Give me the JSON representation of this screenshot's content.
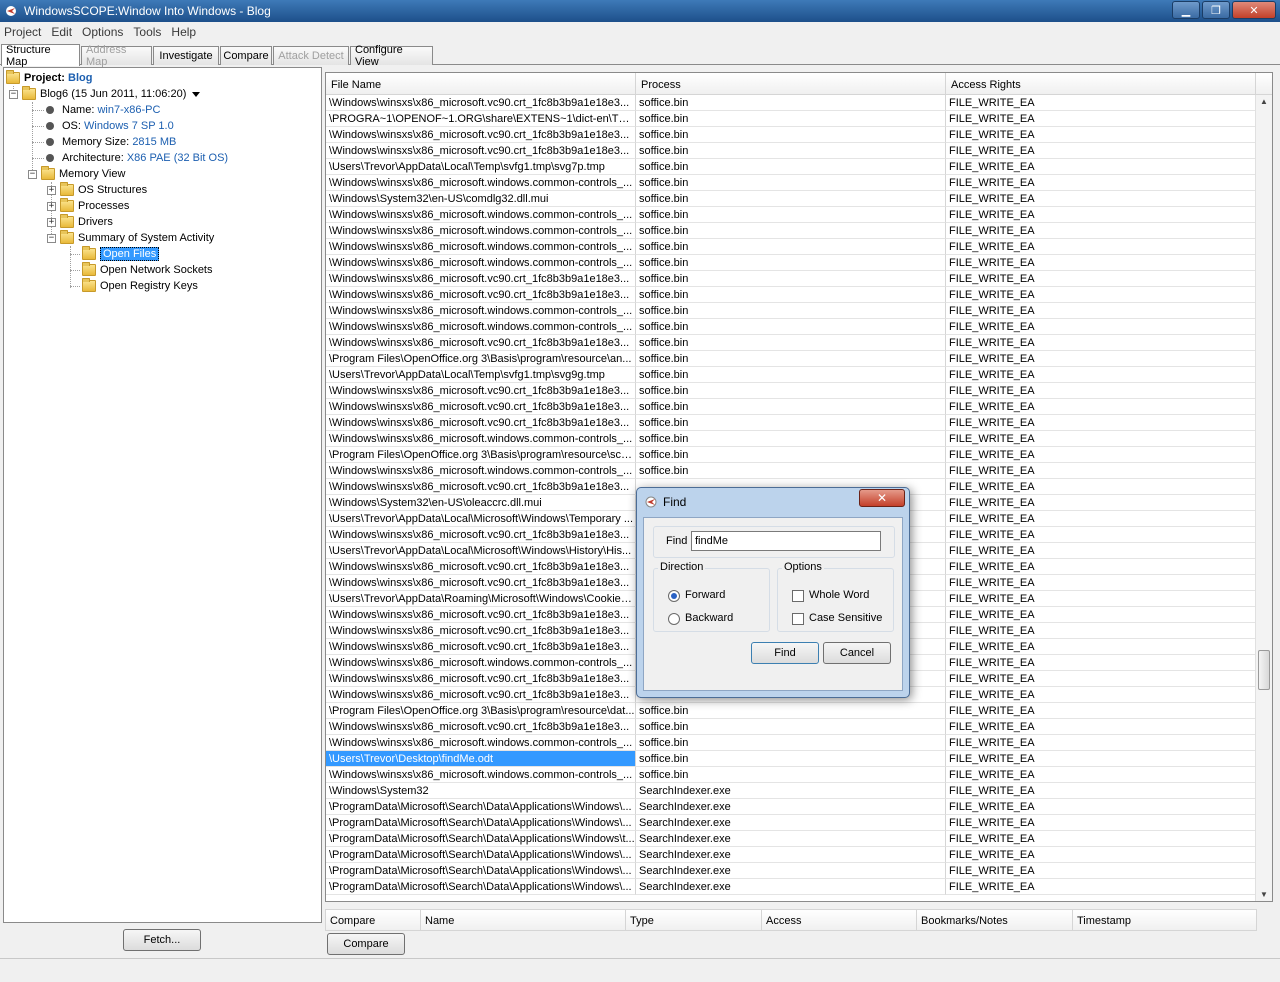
{
  "window": {
    "title": "WindowsSCOPE:Window Into Windows - Blog",
    "minimize": "▁",
    "maximize": "❐",
    "close": "✕"
  },
  "menu": [
    "Project",
    "Edit",
    "Options",
    "Tools",
    "Help"
  ],
  "tabs": [
    {
      "label": "Structure Map",
      "active": true,
      "disabled": false
    },
    {
      "label": "Address Map",
      "active": false,
      "disabled": true
    },
    {
      "label": "Investigate",
      "active": false,
      "disabled": false
    },
    {
      "label": "Compare",
      "active": false,
      "disabled": false
    },
    {
      "label": "Attack Detect",
      "active": false,
      "disabled": true
    },
    {
      "label": "Configure View",
      "active": false,
      "disabled": false
    }
  ],
  "tree": {
    "project_label": "Project:",
    "project_name": "Blog",
    "snapshot": "Blog6 (15 Jun 2011, 11:06:20)",
    "props": [
      {
        "key": "Name:",
        "value": "win7-x86-PC"
      },
      {
        "key": "OS:",
        "value": "Windows 7 SP 1.0"
      },
      {
        "key": "Memory Size:",
        "value": "2815 MB"
      },
      {
        "key": "Architecture:",
        "value": "X86 PAE (32 Bit OS)"
      }
    ],
    "memory_view": "Memory View",
    "children": [
      "OS Structures",
      "Processes",
      "Drivers",
      "Summary of System Activity"
    ],
    "activity": [
      "Open Files",
      "Open Network Sockets",
      "Open Registry Keys"
    ],
    "selected": "Open Files"
  },
  "fetch_label": "Fetch...",
  "table": {
    "columns": [
      "File Name",
      "Process",
      "Access Rights"
    ],
    "rows": [
      [
        "\\Windows\\winsxs\\x86_microsoft.vc90.crt_1fc8b3b9a1e18e3...",
        "soffice.bin",
        "FILE_WRITE_EA"
      ],
      [
        "\\PROGRA~1\\OPENOF~1.ORG\\share\\EXTENS~1\\dict-en\\TH_...",
        "soffice.bin",
        "FILE_WRITE_EA"
      ],
      [
        "\\Windows\\winsxs\\x86_microsoft.vc90.crt_1fc8b3b9a1e18e3...",
        "soffice.bin",
        "FILE_WRITE_EA"
      ],
      [
        "\\Windows\\winsxs\\x86_microsoft.vc90.crt_1fc8b3b9a1e18e3...",
        "soffice.bin",
        "FILE_WRITE_EA"
      ],
      [
        "\\Users\\Trevor\\AppData\\Local\\Temp\\svfg1.tmp\\svg7p.tmp",
        "soffice.bin",
        "FILE_WRITE_EA"
      ],
      [
        "\\Windows\\winsxs\\x86_microsoft.windows.common-controls_...",
        "soffice.bin",
        "FILE_WRITE_EA"
      ],
      [
        "\\Windows\\System32\\en-US\\comdlg32.dll.mui",
        "soffice.bin",
        "FILE_WRITE_EA"
      ],
      [
        "\\Windows\\winsxs\\x86_microsoft.windows.common-controls_...",
        "soffice.bin",
        "FILE_WRITE_EA"
      ],
      [
        "\\Windows\\winsxs\\x86_microsoft.windows.common-controls_...",
        "soffice.bin",
        "FILE_WRITE_EA"
      ],
      [
        "\\Windows\\winsxs\\x86_microsoft.windows.common-controls_...",
        "soffice.bin",
        "FILE_WRITE_EA"
      ],
      [
        "\\Windows\\winsxs\\x86_microsoft.windows.common-controls_...",
        "soffice.bin",
        "FILE_WRITE_EA"
      ],
      [
        "\\Windows\\winsxs\\x86_microsoft.vc90.crt_1fc8b3b9a1e18e3...",
        "soffice.bin",
        "FILE_WRITE_EA"
      ],
      [
        "\\Windows\\winsxs\\x86_microsoft.vc90.crt_1fc8b3b9a1e18e3...",
        "soffice.bin",
        "FILE_WRITE_EA"
      ],
      [
        "\\Windows\\winsxs\\x86_microsoft.windows.common-controls_...",
        "soffice.bin",
        "FILE_WRITE_EA"
      ],
      [
        "\\Windows\\winsxs\\x86_microsoft.windows.common-controls_...",
        "soffice.bin",
        "FILE_WRITE_EA"
      ],
      [
        "\\Windows\\winsxs\\x86_microsoft.vc90.crt_1fc8b3b9a1e18e3...",
        "soffice.bin",
        "FILE_WRITE_EA"
      ],
      [
        "\\Program Files\\OpenOffice.org 3\\Basis\\program\\resource\\an...",
        "soffice.bin",
        "FILE_WRITE_EA"
      ],
      [
        "\\Users\\Trevor\\AppData\\Local\\Temp\\svfg1.tmp\\svg9g.tmp",
        "soffice.bin",
        "FILE_WRITE_EA"
      ],
      [
        "\\Windows\\winsxs\\x86_microsoft.vc90.crt_1fc8b3b9a1e18e3...",
        "soffice.bin",
        "FILE_WRITE_EA"
      ],
      [
        "\\Windows\\winsxs\\x86_microsoft.vc90.crt_1fc8b3b9a1e18e3...",
        "soffice.bin",
        "FILE_WRITE_EA"
      ],
      [
        "\\Windows\\winsxs\\x86_microsoft.vc90.crt_1fc8b3b9a1e18e3...",
        "soffice.bin",
        "FILE_WRITE_EA"
      ],
      [
        "\\Windows\\winsxs\\x86_microsoft.windows.common-controls_...",
        "soffice.bin",
        "FILE_WRITE_EA"
      ],
      [
        "\\Program Files\\OpenOffice.org 3\\Basis\\program\\resource\\sce...",
        "soffice.bin",
        "FILE_WRITE_EA"
      ],
      [
        "\\Windows\\winsxs\\x86_microsoft.windows.common-controls_...",
        "soffice.bin",
        "FILE_WRITE_EA"
      ],
      [
        "\\Windows\\winsxs\\x86_microsoft.vc90.crt_1fc8b3b9a1e18e3...",
        "",
        "FILE_WRITE_EA"
      ],
      [
        "\\Windows\\System32\\en-US\\oleaccrc.dll.mui",
        "",
        "FILE_WRITE_EA"
      ],
      [
        "\\Users\\Trevor\\AppData\\Local\\Microsoft\\Windows\\Temporary ...",
        "",
        "FILE_WRITE_EA"
      ],
      [
        "\\Windows\\winsxs\\x86_microsoft.vc90.crt_1fc8b3b9a1e18e3...",
        "",
        "FILE_WRITE_EA"
      ],
      [
        "\\Users\\Trevor\\AppData\\Local\\Microsoft\\Windows\\History\\His...",
        "",
        "FILE_WRITE_EA"
      ],
      [
        "\\Windows\\winsxs\\x86_microsoft.vc90.crt_1fc8b3b9a1e18e3...",
        "",
        "FILE_WRITE_EA"
      ],
      [
        "\\Windows\\winsxs\\x86_microsoft.vc90.crt_1fc8b3b9a1e18e3...",
        "",
        "FILE_WRITE_EA"
      ],
      [
        "\\Users\\Trevor\\AppData\\Roaming\\Microsoft\\Windows\\Cookies...",
        "",
        "FILE_WRITE_EA"
      ],
      [
        "\\Windows\\winsxs\\x86_microsoft.vc90.crt_1fc8b3b9a1e18e3...",
        "",
        "FILE_WRITE_EA"
      ],
      [
        "\\Windows\\winsxs\\x86_microsoft.vc90.crt_1fc8b3b9a1e18e3...",
        "",
        "FILE_WRITE_EA"
      ],
      [
        "\\Windows\\winsxs\\x86_microsoft.vc90.crt_1fc8b3b9a1e18e3...",
        "",
        "FILE_WRITE_EA"
      ],
      [
        "\\Windows\\winsxs\\x86_microsoft.windows.common-controls_...",
        "",
        "FILE_WRITE_EA"
      ],
      [
        "\\Windows\\winsxs\\x86_microsoft.vc90.crt_1fc8b3b9a1e18e3...",
        "",
        "FILE_WRITE_EA"
      ],
      [
        "\\Windows\\winsxs\\x86_microsoft.vc90.crt_1fc8b3b9a1e18e3...",
        "soffice.bin",
        "FILE_WRITE_EA"
      ],
      [
        "\\Program Files\\OpenOffice.org 3\\Basis\\program\\resource\\dat...",
        "soffice.bin",
        "FILE_WRITE_EA"
      ],
      [
        "\\Windows\\winsxs\\x86_microsoft.vc90.crt_1fc8b3b9a1e18e3...",
        "soffice.bin",
        "FILE_WRITE_EA"
      ],
      [
        "\\Windows\\winsxs\\x86_microsoft.windows.common-controls_...",
        "soffice.bin",
        "FILE_WRITE_EA"
      ],
      [
        "\\Users\\Trevor\\Desktop\\findMe.odt",
        "soffice.bin",
        "FILE_WRITE_EA"
      ],
      [
        "\\Windows\\winsxs\\x86_microsoft.windows.common-controls_...",
        "soffice.bin",
        "FILE_WRITE_EA"
      ],
      [
        "\\Windows\\System32",
        "SearchIndexer.exe",
        "FILE_WRITE_EA"
      ],
      [
        "\\ProgramData\\Microsoft\\Search\\Data\\Applications\\Windows\\...",
        "SearchIndexer.exe",
        "FILE_WRITE_EA"
      ],
      [
        "\\ProgramData\\Microsoft\\Search\\Data\\Applications\\Windows\\...",
        "SearchIndexer.exe",
        "FILE_WRITE_EA"
      ],
      [
        "\\ProgramData\\Microsoft\\Search\\Data\\Applications\\Windows\\t...",
        "SearchIndexer.exe",
        "FILE_WRITE_EA"
      ],
      [
        "\\ProgramData\\Microsoft\\Search\\Data\\Applications\\Windows\\...",
        "SearchIndexer.exe",
        "FILE_WRITE_EA"
      ],
      [
        "\\ProgramData\\Microsoft\\Search\\Data\\Applications\\Windows\\...",
        "SearchIndexer.exe",
        "FILE_WRITE_EA"
      ],
      [
        "\\ProgramData\\Microsoft\\Search\\Data\\Applications\\Windows\\...",
        "SearchIndexer.exe",
        "FILE_WRITE_EA"
      ]
    ],
    "selected_row": 41
  },
  "compare": {
    "columns": [
      "Compare",
      "Name",
      "Type",
      "Access",
      "Bookmarks/Notes",
      "Timestamp"
    ],
    "button": "Compare"
  },
  "find_dialog": {
    "title": "Find",
    "find_label": "Find",
    "find_value": "findMe",
    "direction_label": "Direction",
    "forward": "Forward",
    "backward": "Backward",
    "options_label": "Options",
    "whole_word": "Whole Word",
    "case_sensitive": "Case Sensitive",
    "find_button": "Find",
    "cancel_button": "Cancel",
    "close": "✕"
  },
  "colors": {
    "selection": "#3399ff",
    "link_value": "#1c5fb0",
    "titlebar": "#2a5f9e"
  }
}
